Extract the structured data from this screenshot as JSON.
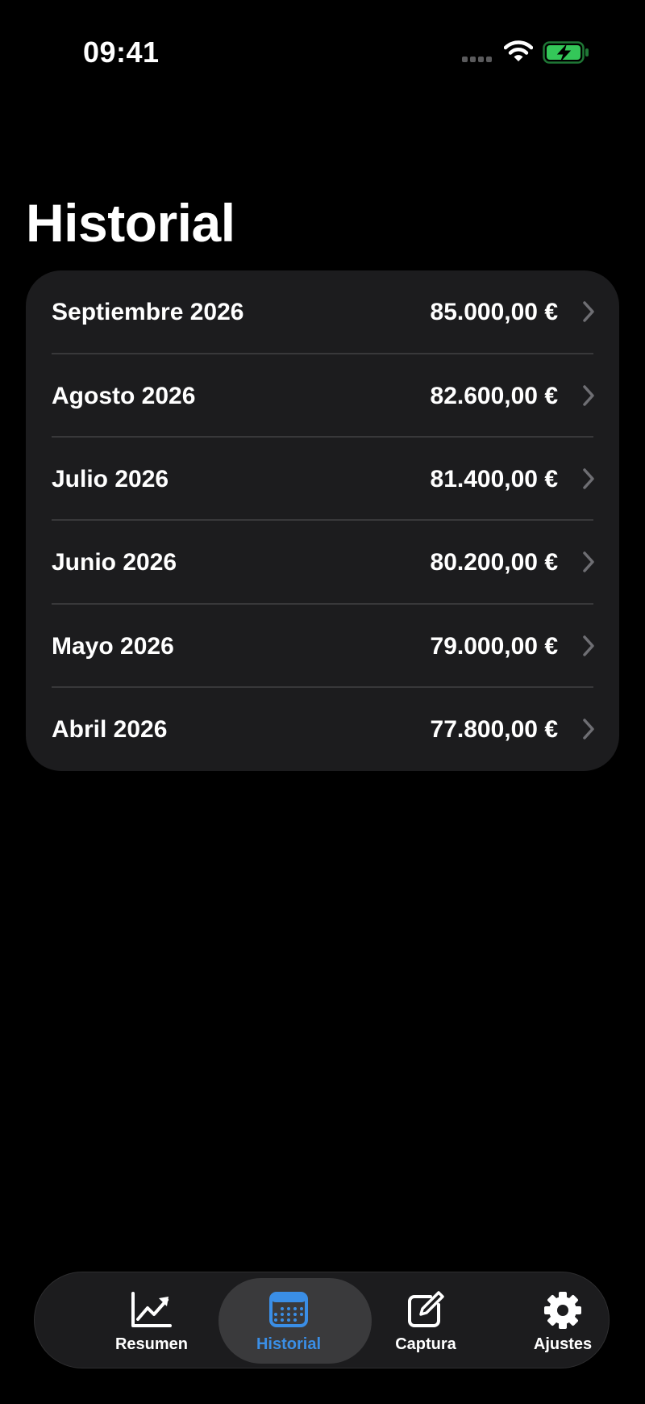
{
  "status_bar": {
    "time": "09:41"
  },
  "page": {
    "title": "Historial"
  },
  "history": [
    {
      "month": "Septiembre 2026",
      "amount": "85.000,00 €"
    },
    {
      "month": "Agosto 2026",
      "amount": "82.600,00 €"
    },
    {
      "month": "Julio 2026",
      "amount": "81.400,00 €"
    },
    {
      "month": "Junio 2026",
      "amount": "80.200,00 €"
    },
    {
      "month": "Mayo 2026",
      "amount": "79.000,00 €"
    },
    {
      "month": "Abril 2026",
      "amount": "77.800,00 €"
    }
  ],
  "tabs": [
    {
      "label": "Resumen",
      "icon": "chart-line-icon",
      "active": false
    },
    {
      "label": "Historial",
      "icon": "calendar-icon",
      "active": true
    },
    {
      "label": "Captura",
      "icon": "edit-icon",
      "active": false
    },
    {
      "label": "Ajustes",
      "icon": "gear-icon",
      "active": false
    }
  ],
  "colors": {
    "accent": "#3a8ee6",
    "battery": "#34c759",
    "card": "#1c1c1e"
  }
}
